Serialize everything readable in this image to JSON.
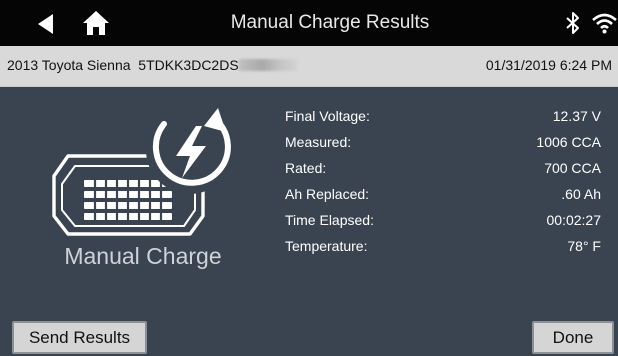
{
  "header": {
    "title": "Manual Charge Results",
    "icons": [
      "back-arrow-icon",
      "home-icon",
      "bluetooth-icon",
      "wifi-icon"
    ]
  },
  "vehicle_bar": {
    "vehicle": "2013 Toyota Sienna",
    "vin_prefix": "5TDKK3DC2DS",
    "datetime": "01/31/2019 6:24 PM"
  },
  "illustration": {
    "label": "Manual Charge",
    "icon": "battery-charging-icon"
  },
  "results": [
    {
      "label": "Final Voltage:",
      "value": "12.37 V"
    },
    {
      "label": "Measured:",
      "value": "1006 CCA"
    },
    {
      "label": "Rated:",
      "value": "700 CCA"
    },
    {
      "label": "Ah Replaced:",
      "value": ".60 Ah"
    },
    {
      "label": "Time Elapsed:",
      "value": "00:02:27"
    },
    {
      "label": "Temperature:",
      "value": "78° F"
    }
  ],
  "actions": {
    "send_results": "Send Results",
    "done": "Done"
  },
  "colors": {
    "title_bar": "#050505",
    "info_bar": "#d9d9d9",
    "background": "#3a4350",
    "button": "#d5d5d5"
  }
}
